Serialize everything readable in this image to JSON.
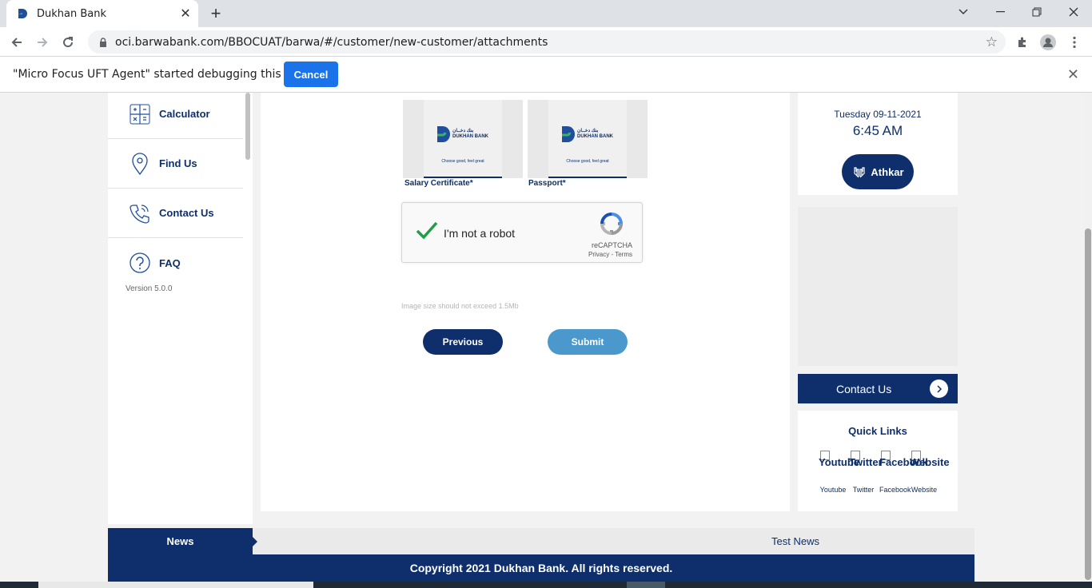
{
  "browser": {
    "tab_title": "Dukhan Bank",
    "url": "oci.barwabank.com/BBOCUAT/barwa/#/customer/new-customer/attachments",
    "infobar_message": "\"Micro Focus UFT Agent\" started debugging this browser",
    "infobar_cancel": "Cancel"
  },
  "sidebar": {
    "items": [
      {
        "label": "Calculator",
        "icon": "calculator-icon"
      },
      {
        "label": "Find Us",
        "icon": "location-pin-icon"
      },
      {
        "label": "Contact Us",
        "icon": "phone-icon"
      },
      {
        "label": "FAQ",
        "icon": "question-icon"
      }
    ],
    "version": "Version 5.0.0"
  },
  "main": {
    "attachments": [
      {
        "label": "Salary Certificate*",
        "logo_text": "بنك دخــان\nDUKHAN BANK",
        "tagline": "Choose good, feel great"
      },
      {
        "label": "Passport*",
        "logo_text": "بنك دخــان\nDUKHAN BANK",
        "tagline": "Choose good, feel great"
      }
    ],
    "captcha": {
      "label": "I'm not a robot",
      "brand": "reCAPTCHA",
      "privacy": "Privacy",
      "terms": "Terms"
    },
    "hint": "Image size should not exceed 1.5Mb",
    "previous_label": "Previous",
    "submit_label": "Submit"
  },
  "rightcol": {
    "date": "Tuesday 09-11-2021",
    "time": "6:45 AM",
    "athkar_label": "Athkar",
    "contact_label": "Contact Us",
    "quick_links_title": "Quick Links",
    "quick_links": [
      {
        "alt": "Youtube",
        "caption": "Youtube"
      },
      {
        "alt": "Twitter",
        "caption": "Twitter"
      },
      {
        "alt": "Facebook",
        "caption": "Facebook"
      },
      {
        "alt": "Website",
        "caption": "Website"
      }
    ]
  },
  "news": {
    "label": "News",
    "ticker": "Test News"
  },
  "footer": {
    "copyright": "Copyright 2021 Dukhan Bank. All rights reserved."
  },
  "colors": {
    "brand_navy": "#0e2f6b",
    "submit_blue": "#4a98cc",
    "chrome_blue": "#1a73e8"
  }
}
